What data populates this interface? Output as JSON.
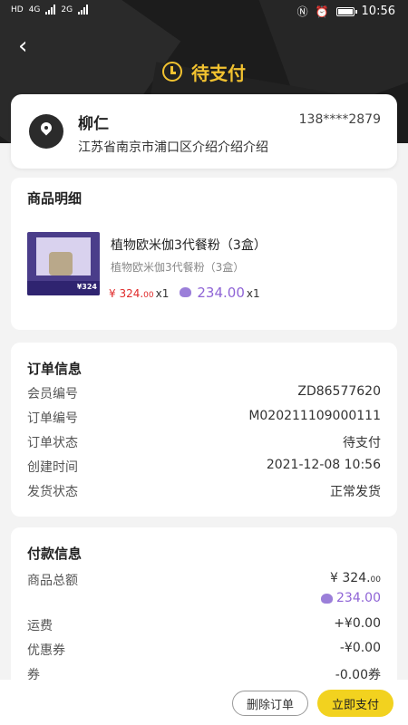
{
  "status_bar": {
    "left_labels": [
      "HD",
      "4G",
      "2G"
    ],
    "time": "10:56"
  },
  "header": {
    "title": "待支付"
  },
  "address": {
    "name": "柳仁",
    "phone": "138****2879",
    "detail": "江苏省南京市浦口区介绍介绍介绍"
  },
  "product_section": {
    "title": "商品明细",
    "thumbnail_price": "¥324",
    "items": [
      {
        "name": "植物欧米伽3代餐粉（3盒）",
        "spec": "植物欧米伽3代餐粉（3盒）",
        "price_int": "¥ 324.",
        "price_dec": "00",
        "price_qty": "x1",
        "points": "234.00",
        "points_qty": "x1"
      }
    ]
  },
  "order_info": {
    "title": "订单信息",
    "rows": [
      {
        "label": "会员编号",
        "value": "ZD86577620"
      },
      {
        "label": "订单编号",
        "value": "M020211109000111"
      },
      {
        "label": "订单状态",
        "value": "待支付"
      },
      {
        "label": "创建时间",
        "value": "2021-12-08 10:56"
      },
      {
        "label": "发货状态",
        "value": "正常发货"
      }
    ]
  },
  "payment_info": {
    "title": "付款信息",
    "total_label": "商品总额",
    "total_int": "¥ 324.",
    "total_dec": "00",
    "total_points": "234.00",
    "rows": [
      {
        "label": "运费",
        "value": "+¥0.00"
      },
      {
        "label": "优惠券",
        "value": "-¥0.00"
      },
      {
        "label": "券",
        "value": "-0.00券"
      }
    ]
  },
  "actions": {
    "delete_label": "删除订单",
    "pay_label": "立即支付"
  },
  "colors": {
    "accent": "#f2c230",
    "header_bg": "#1c1c1c",
    "price_red": "#e02b2b",
    "points_purple": "#8f64d6",
    "pay_button": "#f2d21f"
  }
}
